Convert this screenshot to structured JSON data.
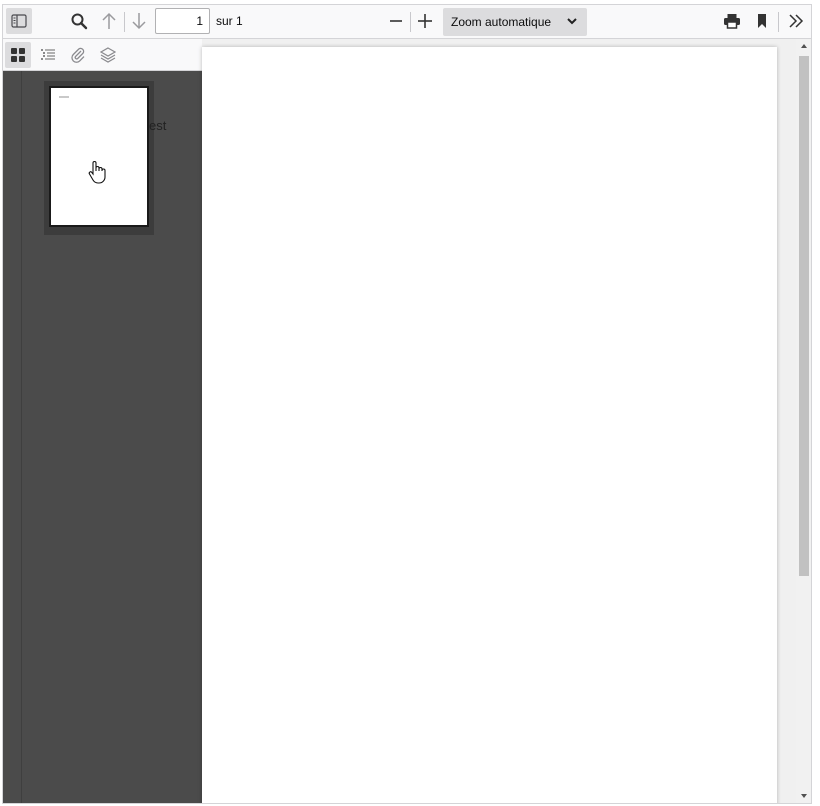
{
  "toolbar": {
    "sidebar_toggle_icon": "sidebar-icon",
    "find_icon": "search-icon",
    "prev_icon": "arrow-up-icon",
    "next_icon": "arrow-down-icon",
    "page_number": "1",
    "page_count": "sur 1",
    "zoom_out_icon": "minus-icon",
    "zoom_in_icon": "plus-icon",
    "zoom_value": "Zoom automatique",
    "print_icon": "printer-icon",
    "bookmark_icon": "bookmark-icon",
    "tools_icon": "double-chevron-right-icon"
  },
  "sidebar": {
    "tabs": [
      {
        "icon": "thumbnails-icon",
        "active": true
      },
      {
        "icon": "outline-icon",
        "active": false
      },
      {
        "icon": "attachments-icon",
        "active": false
      },
      {
        "icon": "layers-icon",
        "active": false
      }
    ],
    "thumbnail_overflow_text": "est"
  },
  "colors": {
    "toolbar_bg": "#f9f9fa",
    "sidebar_bg": "#4b4b4b",
    "viewer_bg": "#f0f0f0",
    "active_button_bg": "#dcdcde"
  }
}
